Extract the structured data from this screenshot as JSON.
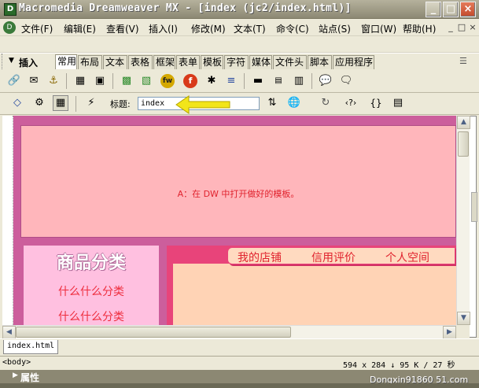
{
  "window": {
    "title": "Macromedia Dreamweaver MX - [index (jc2/index.html)]",
    "app_icon": "dreamweaver-icon",
    "controls": [
      "_",
      "□",
      "×"
    ]
  },
  "menubar": {
    "items": [
      "文件(F)",
      "编辑(E)",
      "查看(V)",
      "插入(I)",
      "修改(M)",
      "文本(T)",
      "命令(C)",
      "站点(S)",
      "窗口(W)",
      "帮助(H)"
    ],
    "mdi_controls": [
      "_",
      "□",
      "×"
    ]
  },
  "insert_panel": {
    "label": "插入",
    "tabs": [
      "常用",
      "布局",
      "文本",
      "表格",
      "框架",
      "表单",
      "模板",
      "字符",
      "媒体",
      "文件头",
      "脚本",
      "应用程序"
    ],
    "active_tab": "常用"
  },
  "document_toolbar": {
    "title_label": "标题:",
    "title_value": "index"
  },
  "page": {
    "banner_text": "A：在 DW 中打开做好的模板。",
    "category_title": "商品分类",
    "category_items": [
      "什么什么分类",
      "什么什么分类"
    ],
    "nav_links": [
      "我的店铺",
      "信用评价",
      "个人空间"
    ]
  },
  "file_tab": "index.html",
  "statusbar": {
    "tag": "<body>",
    "info": "594 x 284 ↓ 95 K / 27 秒"
  },
  "properties_bar": {
    "label": "属性"
  },
  "watermark": "Dongxin91860 51.com",
  "colors": {
    "page_bg": "#cc5e9c",
    "banner_bg": "#ffb6bb",
    "accent_red": "#e0232e",
    "annotation_arrow": "#f2e51a"
  }
}
